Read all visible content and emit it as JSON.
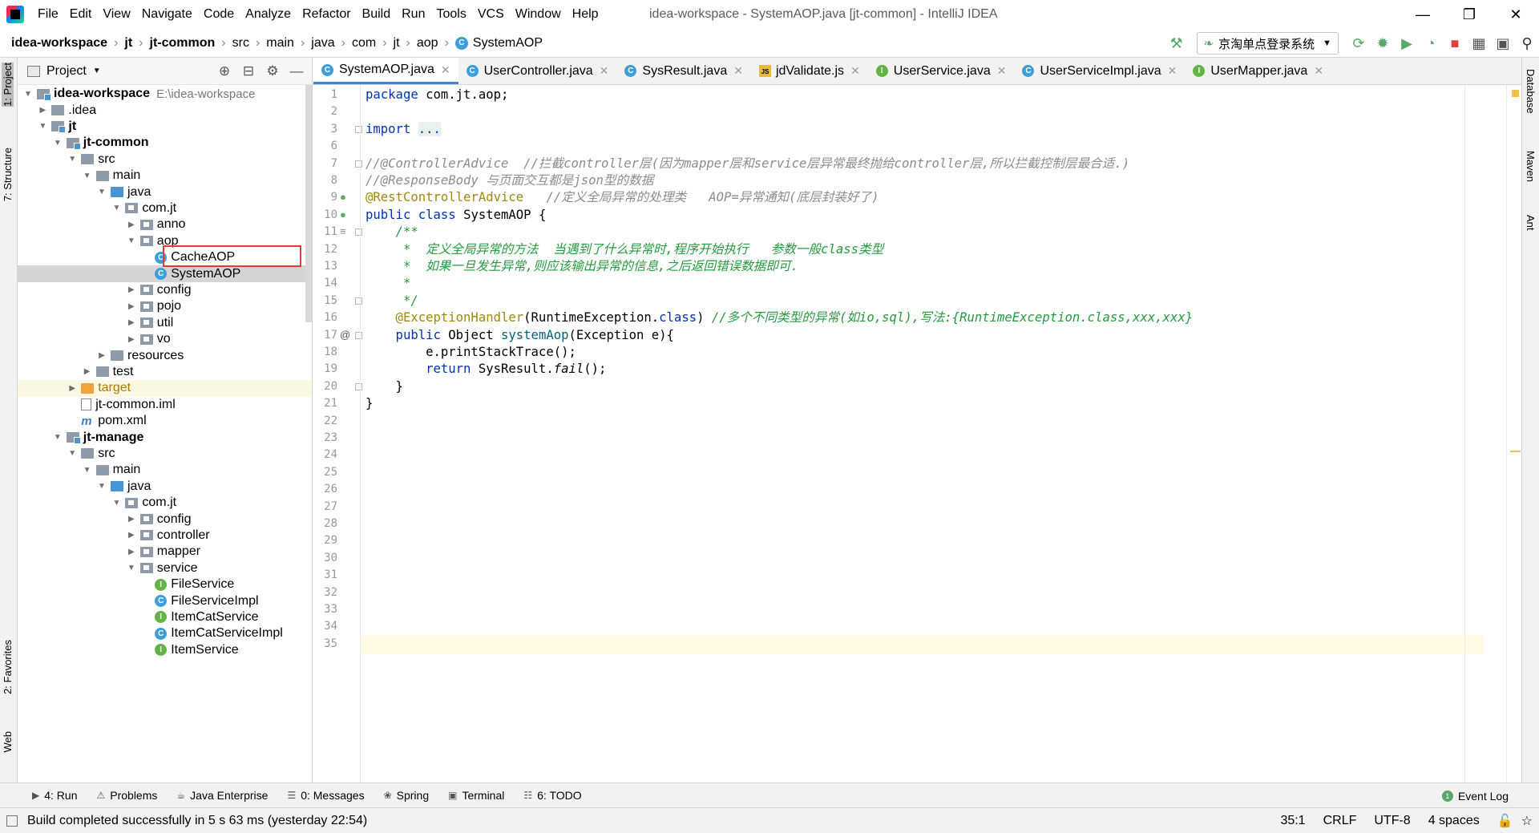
{
  "window": {
    "title": "idea-workspace - SystemAOP.java [jt-common] - IntelliJ IDEA",
    "menu": [
      "File",
      "Edit",
      "View",
      "Navigate",
      "Code",
      "Analyze",
      "Refactor",
      "Build",
      "Run",
      "Tools",
      "VCS",
      "Window",
      "Help"
    ]
  },
  "breadcrumb": [
    "idea-workspace",
    "jt",
    "jt-common",
    "src",
    "main",
    "java",
    "com",
    "jt",
    "aop",
    "SystemAOP"
  ],
  "run_config": "京淘单点登录系统",
  "left_strip": [
    "1: Project",
    "7: Structure",
    "2: Favorites",
    "Web"
  ],
  "right_strip": [
    "Database",
    "Maven",
    "Ant"
  ],
  "project_panel": {
    "title": "Project",
    "tree": [
      {
        "label": "idea-workspace",
        "extra": "E:\\idea-workspace",
        "arrow": "▼",
        "icon": "module",
        "bold": true
      },
      {
        "label": ".idea",
        "arrow": "▶",
        "icon": "folder"
      },
      {
        "label": "jt",
        "arrow": "▼",
        "icon": "module",
        "bold": true
      },
      {
        "label": "jt-common",
        "arrow": "▼",
        "icon": "module",
        "bold": true
      },
      {
        "label": "src",
        "arrow": "▼",
        "icon": "folder"
      },
      {
        "label": "main",
        "arrow": "▼",
        "icon": "folder"
      },
      {
        "label": "java",
        "arrow": "▼",
        "icon": "folder-blue"
      },
      {
        "label": "com.jt",
        "arrow": "▼",
        "icon": "pkg"
      },
      {
        "label": "anno",
        "arrow": "▶",
        "icon": "pkg"
      },
      {
        "label": "aop",
        "arrow": "▼",
        "icon": "pkg"
      },
      {
        "label": "CacheAOP",
        "arrow": "",
        "icon": "class"
      },
      {
        "label": "SystemAOP",
        "arrow": "",
        "icon": "class",
        "selected": true
      },
      {
        "label": "config",
        "arrow": "▶",
        "icon": "pkg"
      },
      {
        "label": "pojo",
        "arrow": "▶",
        "icon": "pkg"
      },
      {
        "label": "util",
        "arrow": "▶",
        "icon": "pkg"
      },
      {
        "label": "vo",
        "arrow": "▶",
        "icon": "pkg"
      },
      {
        "label": "resources",
        "arrow": "▶",
        "icon": "folder"
      },
      {
        "label": "test",
        "arrow": "▶",
        "icon": "folder"
      },
      {
        "label": "target",
        "arrow": "▶",
        "icon": "folder-orange",
        "excluded": true
      },
      {
        "label": "jt-common.iml",
        "arrow": "",
        "icon": "iml"
      },
      {
        "label": "pom.xml",
        "arrow": "",
        "icon": "maven"
      },
      {
        "label": "jt-manage",
        "arrow": "▼",
        "icon": "module",
        "bold": true
      },
      {
        "label": "src",
        "arrow": "▼",
        "icon": "folder"
      },
      {
        "label": "main",
        "arrow": "▼",
        "icon": "folder"
      },
      {
        "label": "java",
        "arrow": "▼",
        "icon": "folder-blue"
      },
      {
        "label": "com.jt",
        "arrow": "▼",
        "icon": "pkg"
      },
      {
        "label": "config",
        "arrow": "▶",
        "icon": "pkg"
      },
      {
        "label": "controller",
        "arrow": "▶",
        "icon": "pkg"
      },
      {
        "label": "mapper",
        "arrow": "▶",
        "icon": "pkg"
      },
      {
        "label": "service",
        "arrow": "▼",
        "icon": "pkg"
      },
      {
        "label": "FileService",
        "arrow": "",
        "icon": "interface"
      },
      {
        "label": "FileServiceImpl",
        "arrow": "",
        "icon": "class"
      },
      {
        "label": "ItemCatService",
        "arrow": "",
        "icon": "interface"
      },
      {
        "label": "ItemCatServiceImpl",
        "arrow": "",
        "icon": "class"
      },
      {
        "label": "ItemService",
        "arrow": "",
        "icon": "interface"
      }
    ]
  },
  "tabs": [
    {
      "label": "SystemAOP.java",
      "icon": "class",
      "active": true
    },
    {
      "label": "UserController.java",
      "icon": "class"
    },
    {
      "label": "SysResult.java",
      "icon": "class"
    },
    {
      "label": "jdValidate.js",
      "icon": "js"
    },
    {
      "label": "UserService.java",
      "icon": "interface"
    },
    {
      "label": "UserServiceImpl.java",
      "icon": "class"
    },
    {
      "label": "UserMapper.java",
      "icon": "interface"
    }
  ],
  "editor": {
    "line_numbers": [
      "1",
      "2",
      "3",
      "6",
      "7",
      "8",
      "9",
      "10",
      "11",
      "12",
      "13",
      "14",
      "15",
      "16",
      "17",
      "18",
      "19",
      "20",
      "21",
      "22",
      "23",
      "24",
      "25",
      "26",
      "27",
      "28",
      "29",
      "30",
      "31",
      "32",
      "33",
      "34",
      "35"
    ],
    "lines": [
      [
        {
          "t": "package ",
          "c": "kw"
        },
        {
          "t": "com.jt.aop;",
          "c": ""
        }
      ],
      [],
      [
        {
          "t": "import ",
          "c": "kw"
        },
        {
          "t": "...",
          "c": "folded"
        }
      ],
      [],
      [
        {
          "t": "//@ControllerAdvice  //拦截controller层(因为mapper层和service层异常最终抛给controller层,所以拦截控制层最合适.)",
          "c": "cm"
        }
      ],
      [
        {
          "t": "//@ResponseBody 与页面交互都是json型的数据",
          "c": "cm"
        }
      ],
      [
        {
          "t": "@RestControllerAdvice",
          "c": "ann"
        },
        {
          "t": "   //定义全局异常的处理类   AOP=异常通知(底层封装好了)",
          "c": "cm"
        }
      ],
      [
        {
          "t": "public class ",
          "c": "kw"
        },
        {
          "t": "SystemAOP {",
          "c": ""
        }
      ],
      [
        {
          "t": "    /**",
          "c": "doc"
        }
      ],
      [
        {
          "t": "     *  定义全局异常的方法  当遇到了什么异常时,程序开始执行   参数一般class类型",
          "c": "doc"
        }
      ],
      [
        {
          "t": "     *  如果一旦发生异常,则应该输出异常的信息,之后返回错误数据即可.",
          "c": "doc"
        }
      ],
      [
        {
          "t": "     *",
          "c": "doc"
        }
      ],
      [
        {
          "t": "     */",
          "c": "doc"
        }
      ],
      [
        {
          "t": "    @ExceptionHandler",
          "c": "ann"
        },
        {
          "t": "(RuntimeException.",
          "c": ""
        },
        {
          "t": "class",
          "c": "kw"
        },
        {
          "t": ") ",
          "c": ""
        },
        {
          "t": "//多个不同类型的异常(如io,sql),写法:{RuntimeException.class,xxx,xxx}",
          "c": "doc"
        }
      ],
      [
        {
          "t": "    public ",
          "c": "kw"
        },
        {
          "t": "Object ",
          "c": ""
        },
        {
          "t": "systemAop",
          "c": "fn"
        },
        {
          "t": "(Exception e){",
          "c": ""
        }
      ],
      [
        {
          "t": "        e.printStackTrace();",
          "c": ""
        }
      ],
      [
        {
          "t": "        return ",
          "c": "kw"
        },
        {
          "t": "SysResult.",
          "c": ""
        },
        {
          "t": "fail",
          "c": "it"
        },
        {
          "t": "();",
          "c": ""
        }
      ],
      [
        {
          "t": "    }",
          "c": ""
        }
      ],
      [
        {
          "t": "}",
          "c": ""
        }
      ],
      [],
      [],
      [],
      [],
      [],
      [],
      [],
      [],
      [],
      [],
      [],
      [],
      [],
      []
    ],
    "cursor_line": "35"
  },
  "bottom_tools": [
    {
      "label": "4: Run",
      "icon": "▶"
    },
    {
      "label": "Problems",
      "icon": "⚠"
    },
    {
      "label": "Java Enterprise",
      "icon": "☕"
    },
    {
      "label": "0: Messages",
      "icon": "☰"
    },
    {
      "label": "Spring",
      "icon": "❀"
    },
    {
      "label": "Terminal",
      "icon": "▣"
    },
    {
      "label": "6: TODO",
      "icon": "☷"
    }
  ],
  "event_log": "Event Log",
  "status": {
    "message": "Build completed successfully in 5 s 63 ms (yesterday 22:54)",
    "position": "35:1",
    "line_sep": "CRLF",
    "encoding": "UTF-8",
    "indent": "4 spaces"
  }
}
